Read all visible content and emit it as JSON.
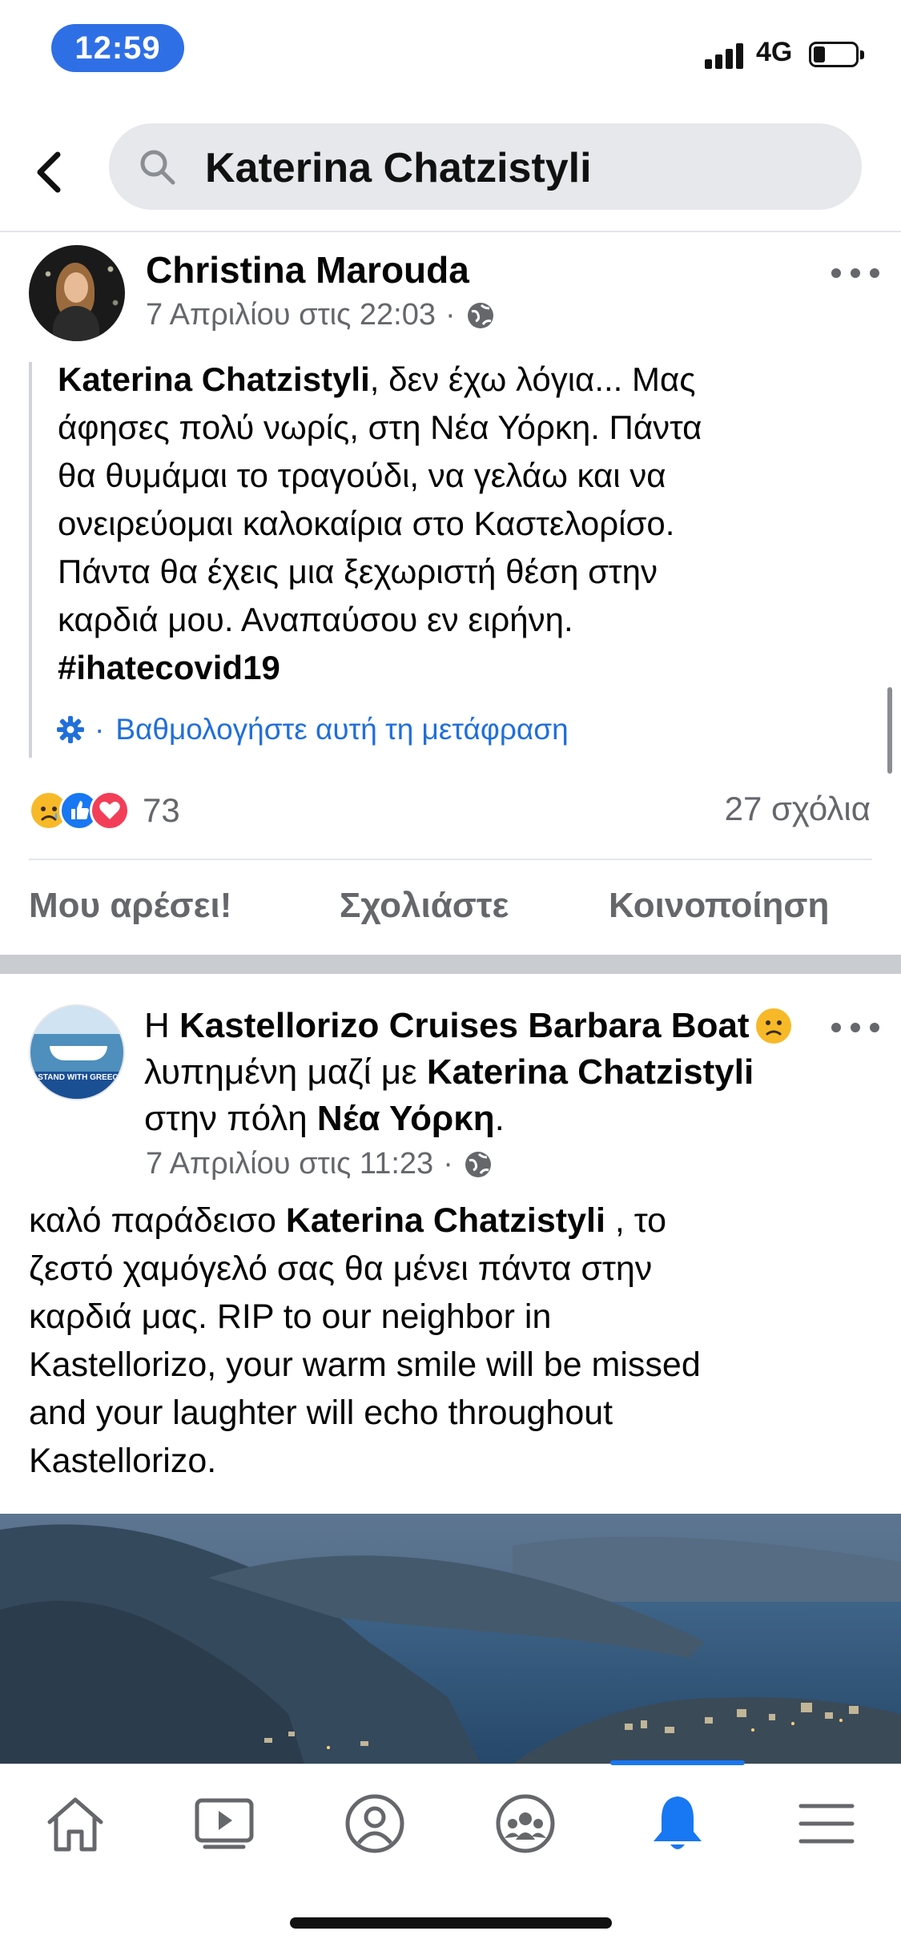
{
  "status_bar": {
    "time": "12:59",
    "network": "4G"
  },
  "search": {
    "query": "Katerina Chatzistyli"
  },
  "post1": {
    "author": "Christina Marouda",
    "date": "7 Απριλίου στις 22:03",
    "dot": "·",
    "text_lines": [
      {
        "bold": "Katerina Chatzistyli",
        "rest": ", δεν έχω λόγια... Μας"
      },
      {
        "bold": "",
        "rest": "άφησες πολύ νωρίς, στη Νέα Υόρκη. Πάντα"
      },
      {
        "bold": "",
        "rest": "θα θυμάμαι το τραγούδι, να γελάω και να"
      },
      {
        "bold": "",
        "rest": "ονειρεύομαι καλοκαίρια στο Καστελορίσο."
      },
      {
        "bold": "",
        "rest": "Πάντα θα έχεις μια ξεχωριστή θέση στην"
      },
      {
        "bold": "",
        "rest": "καρδιά μου. Αναπαύσου εν ειρήνη."
      },
      {
        "bold": "#ihatecovid19",
        "rest": ""
      }
    ],
    "rate_translation": "Βαθμολογήστε αυτή τη μετάφραση",
    "reaction_count": "73",
    "comment_count": "27 σχόλια",
    "actions": {
      "like": "Μου αρέσει!",
      "comment": "Σχολιάστε",
      "share": "Κοινοποίηση"
    }
  },
  "post2": {
    "avatar_text": "I STAND WITH GREECE",
    "headline": {
      "prefix": "Η ",
      "page": "Kastellorizo Cruises Barbara Boat",
      "feeling": "λυπημένη μαζί με ",
      "with": "Katerina Chatzistyli",
      "place_prefix": " στην πόλη ",
      "place": "Νέα Υόρκη",
      "end": "."
    },
    "date": "7 Απριλίου στις 11:23",
    "dot": "·",
    "text_lines": [
      {
        "pre": "καλό παράδεισο ",
        "bold": "Katerina Chatzistyli",
        "post": " , το"
      },
      {
        "pre": "ζεστό χαμόγελό σας θα μένει πάντα στην",
        "bold": "",
        "post": ""
      },
      {
        "pre": "καρδιά μας. RIP  to our neighbor in",
        "bold": "",
        "post": ""
      },
      {
        "pre": "Kastellorizo, your warm smile will be missed",
        "bold": "",
        "post": ""
      },
      {
        "pre": "and your laughter will echo throughout",
        "bold": "",
        "post": ""
      },
      {
        "pre": "Kastellorizo.",
        "bold": "",
        "post": ""
      }
    ]
  },
  "nav": {
    "items": [
      "home-icon",
      "watch-icon",
      "profile-icon",
      "groups-icon",
      "notifications-icon",
      "menu-icon"
    ],
    "active": "notifications-icon",
    "active_color": "#1877f2"
  },
  "colors": {
    "link_blue": "#216fdb",
    "secondary_text": "#65676b",
    "status_pill": "#2f6fe6"
  }
}
